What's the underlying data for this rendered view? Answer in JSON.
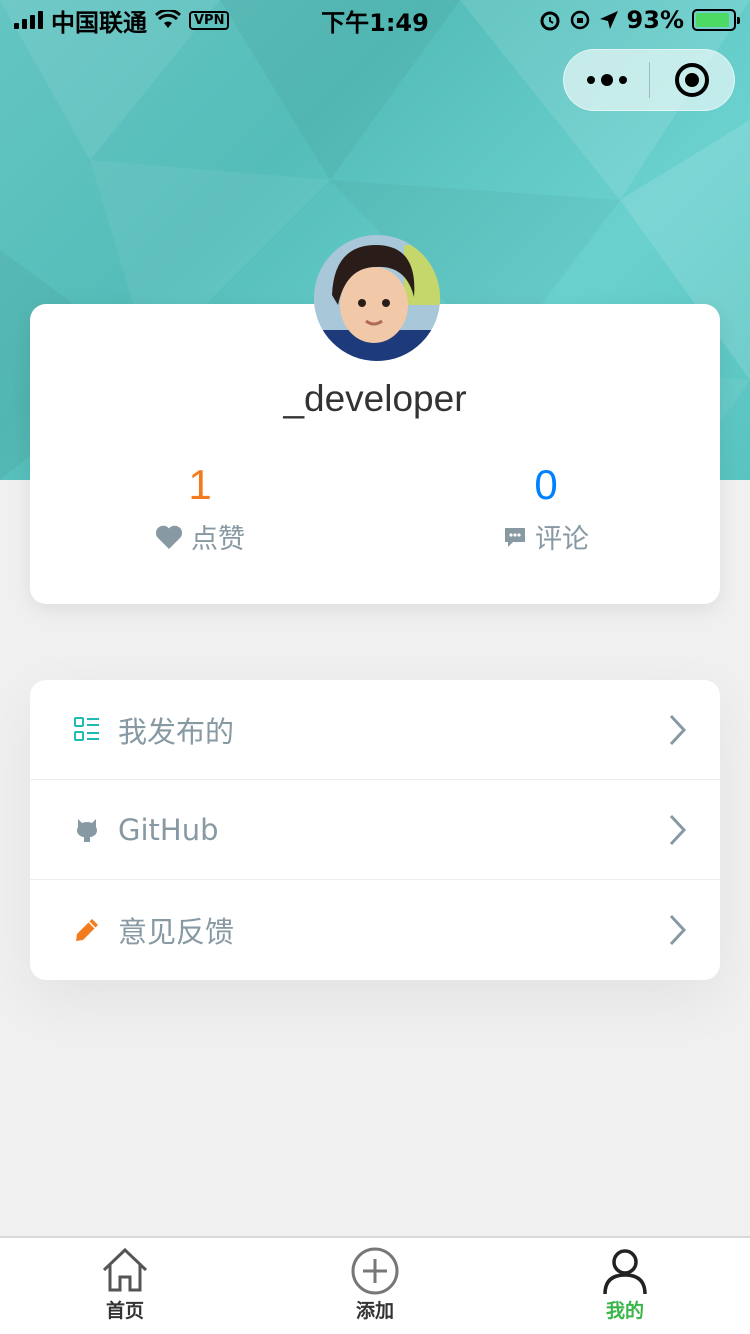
{
  "status_bar": {
    "carrier": "中国联通",
    "vpn": "VPN",
    "time": "下午1:49",
    "battery": "93%",
    "battery_level": 0.93
  },
  "capsule": {
    "more_icon": "more-dots-icon",
    "close_icon": "target-close-icon"
  },
  "profile": {
    "username": "_developer",
    "likes_count": "1",
    "likes_label": "点赞",
    "comments_count": "0",
    "comments_label": "评论"
  },
  "menu": {
    "items": [
      {
        "label": "我发布的",
        "icon": "list-icon",
        "color": "#1cbbb4"
      },
      {
        "label": "GitHub",
        "icon": "github-icon",
        "color": "#8799a3"
      },
      {
        "label": "意见反馈",
        "icon": "pencil-icon",
        "color": "#f37b1d"
      }
    ]
  },
  "tabbar": {
    "items": [
      {
        "label": "首页",
        "icon": "home-icon"
      },
      {
        "label": "添加",
        "icon": "add-circle-icon"
      },
      {
        "label": "我的",
        "icon": "user-icon"
      }
    ],
    "active_color": "#39b54a"
  },
  "colors": {
    "hero": "#5fc4c1",
    "likes": "#f37b1d",
    "comments": "#0081ff",
    "muted": "#8799a3"
  }
}
